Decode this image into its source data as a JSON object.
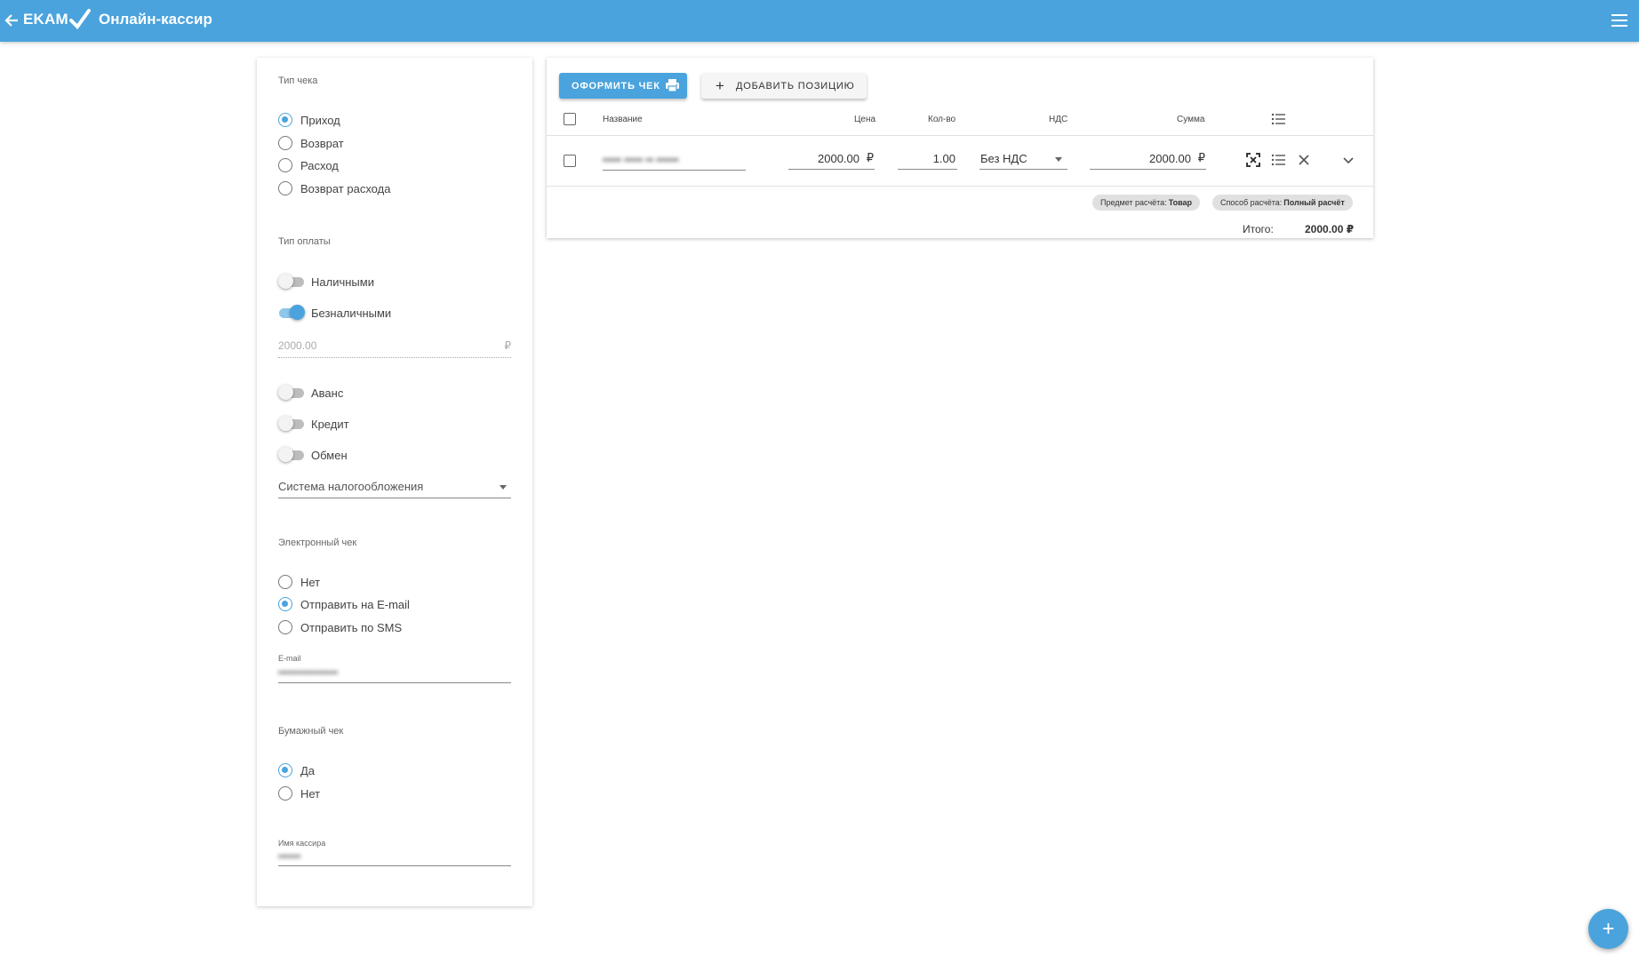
{
  "header": {
    "brand": "EKAM",
    "title": "Онлайн-кассир"
  },
  "receipt_type": {
    "label": "Тип чека",
    "options": [
      "Приход",
      "Возврат",
      "Расход",
      "Возврат расхода"
    ],
    "selected": "Приход"
  },
  "payment_type": {
    "label": "Тип оплаты",
    "cash": {
      "label": "Наличными",
      "on": false
    },
    "cashless": {
      "label": "Безналичными",
      "on": true
    },
    "amount": "2000.00",
    "currency": "₽",
    "advance": {
      "label": "Аванс",
      "on": false
    },
    "credit": {
      "label": "Кредит",
      "on": false
    },
    "exchange": {
      "label": "Обмен",
      "on": false
    }
  },
  "tax_system": {
    "placeholder": "Система налогообложения"
  },
  "electronic_receipt": {
    "label": "Электронный чек",
    "options": [
      "Нет",
      "Отправить на E-mail",
      "Отправить по SMS"
    ],
    "selected": "Отправить на E-mail",
    "email_label": "E-mail",
    "email_value": "••••••••••••••••"
  },
  "paper_receipt": {
    "label": "Бумажный чек",
    "options": [
      "Да",
      "Нет"
    ],
    "selected": "Да"
  },
  "cashier": {
    "label": "Имя кассира",
    "value": "••••••"
  },
  "toolbar": {
    "issue_label": "ОФОРМИТЬ ЧЕК",
    "add_label": "ДОБАВИТЬ ПОЗИЦИЮ"
  },
  "table": {
    "columns": [
      "Название",
      "Цена",
      "Кол-во",
      "НДС",
      "Сумма"
    ],
    "rows": [
      {
        "name": "••••• ••••• •• ••••••",
        "price": "2000.00",
        "currency": "₽",
        "qty": "1.00",
        "vat": "Без НДС",
        "sum": "2000.00"
      }
    ],
    "chips": [
      {
        "label": "Предмет расчёта:",
        "value": "Товар"
      },
      {
        "label": "Способ расчёта:",
        "value": "Полный расчёт"
      }
    ],
    "total_label": "Итого:",
    "total_value": "2000.00 ₽"
  },
  "colors": {
    "accent": "#4aa3dc",
    "appbar": "#4aa3dc"
  },
  "icons": {
    "back": "arrow-left-icon",
    "check": "checkmark-icon",
    "menu": "hamburger-menu-icon",
    "printer": "printer-icon",
    "add": "plus-icon",
    "columns": "list-icon",
    "scan": "scan-icon",
    "details": "list-icon",
    "delete": "close-icon",
    "expand": "chevron-down-icon",
    "fab": "plus-icon"
  }
}
